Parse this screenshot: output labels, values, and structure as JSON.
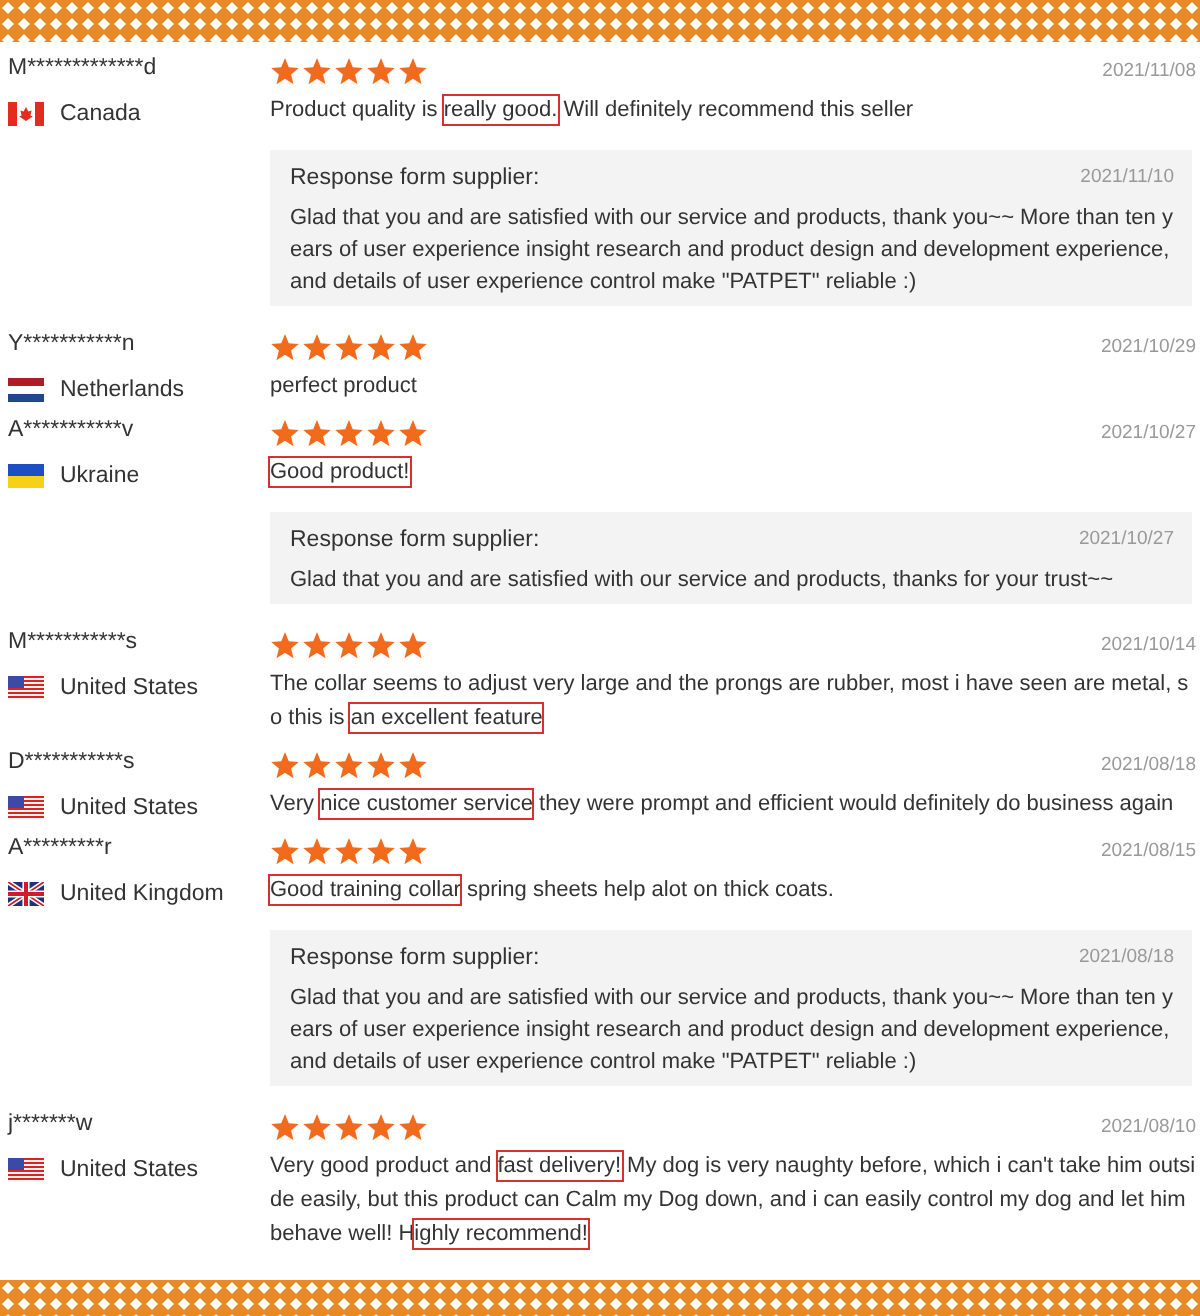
{
  "reviews": [
    {
      "name": "M*************d",
      "country": "Canada",
      "kind": "ca",
      "stars": 5,
      "date": "2021/11/08",
      "text": [
        {
          "text": "Product quality is ",
          "highlighted": false
        },
        {
          "text": "really good.",
          "highlighted": true
        },
        {
          "text": " Will definitely recommend this seller",
          "highlighted": false
        }
      ],
      "response": {
        "label": "Response form supplier:",
        "date": "2021/11/10",
        "text": "Glad that you and are satisfied with our service and products, thank you~~ More than ten years of user experience insight research and product design and development experience, and details of user experience control make \"PATPET\" reliable :)"
      }
    },
    {
      "name": "Y***********n",
      "country": "Netherlands",
      "kind": "nl",
      "stars": 5,
      "date": "2021/10/29",
      "text": [
        {
          "text": "perfect product",
          "highlighted": false
        }
      ]
    },
    {
      "name": "A***********v",
      "country": "Ukraine",
      "kind": "ua",
      "stars": 5,
      "date": "2021/10/27",
      "text": [
        {
          "text": "Good product!",
          "highlighted": true
        }
      ],
      "response": {
        "label": "Response form supplier:",
        "date": "2021/10/27",
        "text": "Glad that you and are satisfied with our service and products, thanks for your trust~~"
      }
    },
    {
      "name": "M***********s",
      "country": "United States",
      "kind": "us",
      "stars": 5,
      "date": "2021/10/14",
      "text": [
        {
          "text": "The collar seems to adjust very large and the prongs are rubber, most i have seen are metal, so this is ",
          "highlighted": false
        },
        {
          "text": "an excellent feature",
          "highlighted": true
        }
      ]
    },
    {
      "name": "D***********s",
      "country": "United States",
      "kind": "us",
      "stars": 5,
      "date": "2021/08/18",
      "text": [
        {
          "text": "Very ",
          "highlighted": false
        },
        {
          "text": "nice customer service",
          "highlighted": true
        },
        {
          "text": " they were prompt and efficient would definitely do business again",
          "highlighted": false
        }
      ]
    },
    {
      "name": "A*********r",
      "country": "United Kingdom",
      "kind": "gb",
      "stars": 5,
      "date": "2021/08/15",
      "text": [
        {
          "text": "Good training collar",
          "highlighted": true
        },
        {
          "text": " spring sheets help alot on thick coats.",
          "highlighted": false
        }
      ],
      "response": {
        "label": "Response form supplier:",
        "date": "2021/08/18",
        "text": "Glad that you and are satisfied with our service and products, thank you~~ More than ten years of user experience insight research and product design and development experience, and details of user experience control make \"PATPET\" reliable :)"
      }
    },
    {
      "name": "j*******w",
      "country": "United States",
      "kind": "us",
      "stars": 5,
      "date": "2021/08/10",
      "text": [
        {
          "text": "Very good product and ",
          "highlighted": false
        },
        {
          "text": "fast delivery!",
          "highlighted": true
        },
        {
          "text": " My dog is very naughty before, which i can't take him outside easily, but this product can Calm my Dog down, and i can easily control my dog and let him behave well! H",
          "highlighted": false
        },
        {
          "text": "ighly recommend!",
          "highlighted": true
        }
      ]
    }
  ]
}
